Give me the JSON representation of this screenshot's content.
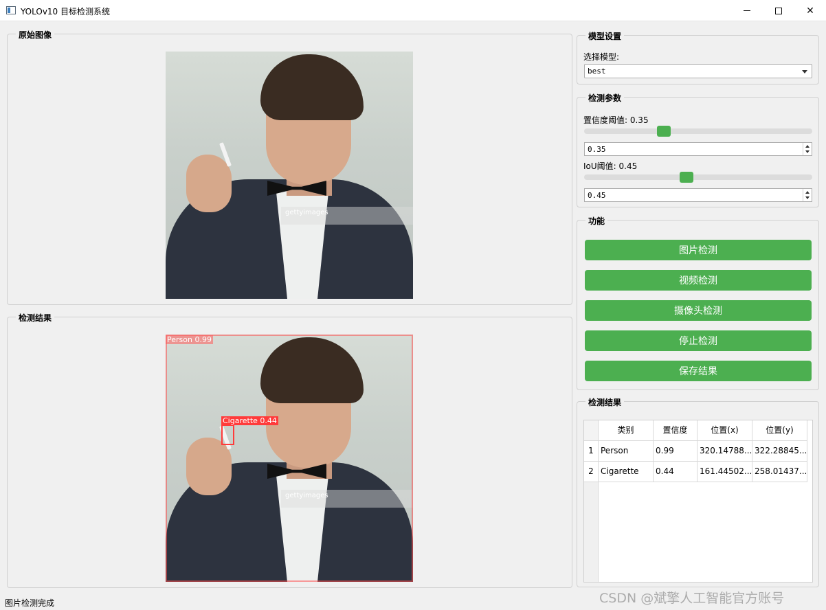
{
  "window": {
    "title": "YOLOv10 目标检测系统"
  },
  "original_panel": {
    "title": "原始图像",
    "watermark": "gettyimages"
  },
  "result_panel": {
    "title": "检测结果",
    "watermark": "gettyimages",
    "detections": [
      {
        "label": "Person 0.99"
      },
      {
        "label": "Cigarette 0.44"
      }
    ]
  },
  "model_settings": {
    "title": "模型设置",
    "select_label": "选择模型:",
    "selected_model": "best"
  },
  "detect_params": {
    "title": "检测参数",
    "confidence_label": "置信度阈值: 0.35",
    "confidence_value": "0.35",
    "confidence_fraction": 0.35,
    "iou_label": "IoU阈值: 0.45",
    "iou_value": "0.45",
    "iou_fraction": 0.45
  },
  "functions": {
    "title": "功能",
    "buttons": [
      "图片检测",
      "视频检测",
      "摄像头检测",
      "停止检测",
      "保存结果"
    ]
  },
  "results_table": {
    "title": "检测结果",
    "columns": [
      "类别",
      "置信度",
      "位置(x)",
      "位置(y)"
    ],
    "rows": [
      {
        "index": "1",
        "class": "Person",
        "confidence": "0.99",
        "x": "320.14788...",
        "y": "322.28845..."
      },
      {
        "index": "2",
        "class": "Cigarette",
        "confidence": "0.44",
        "x": "161.44502...",
        "y": "258.01437..."
      }
    ]
  },
  "status": "图片检测完成",
  "watermark": "CSDN @斌擎人工智能官方账号",
  "colors": {
    "accent_green": "#4caf50",
    "detection_red": "#ff3b3b"
  }
}
